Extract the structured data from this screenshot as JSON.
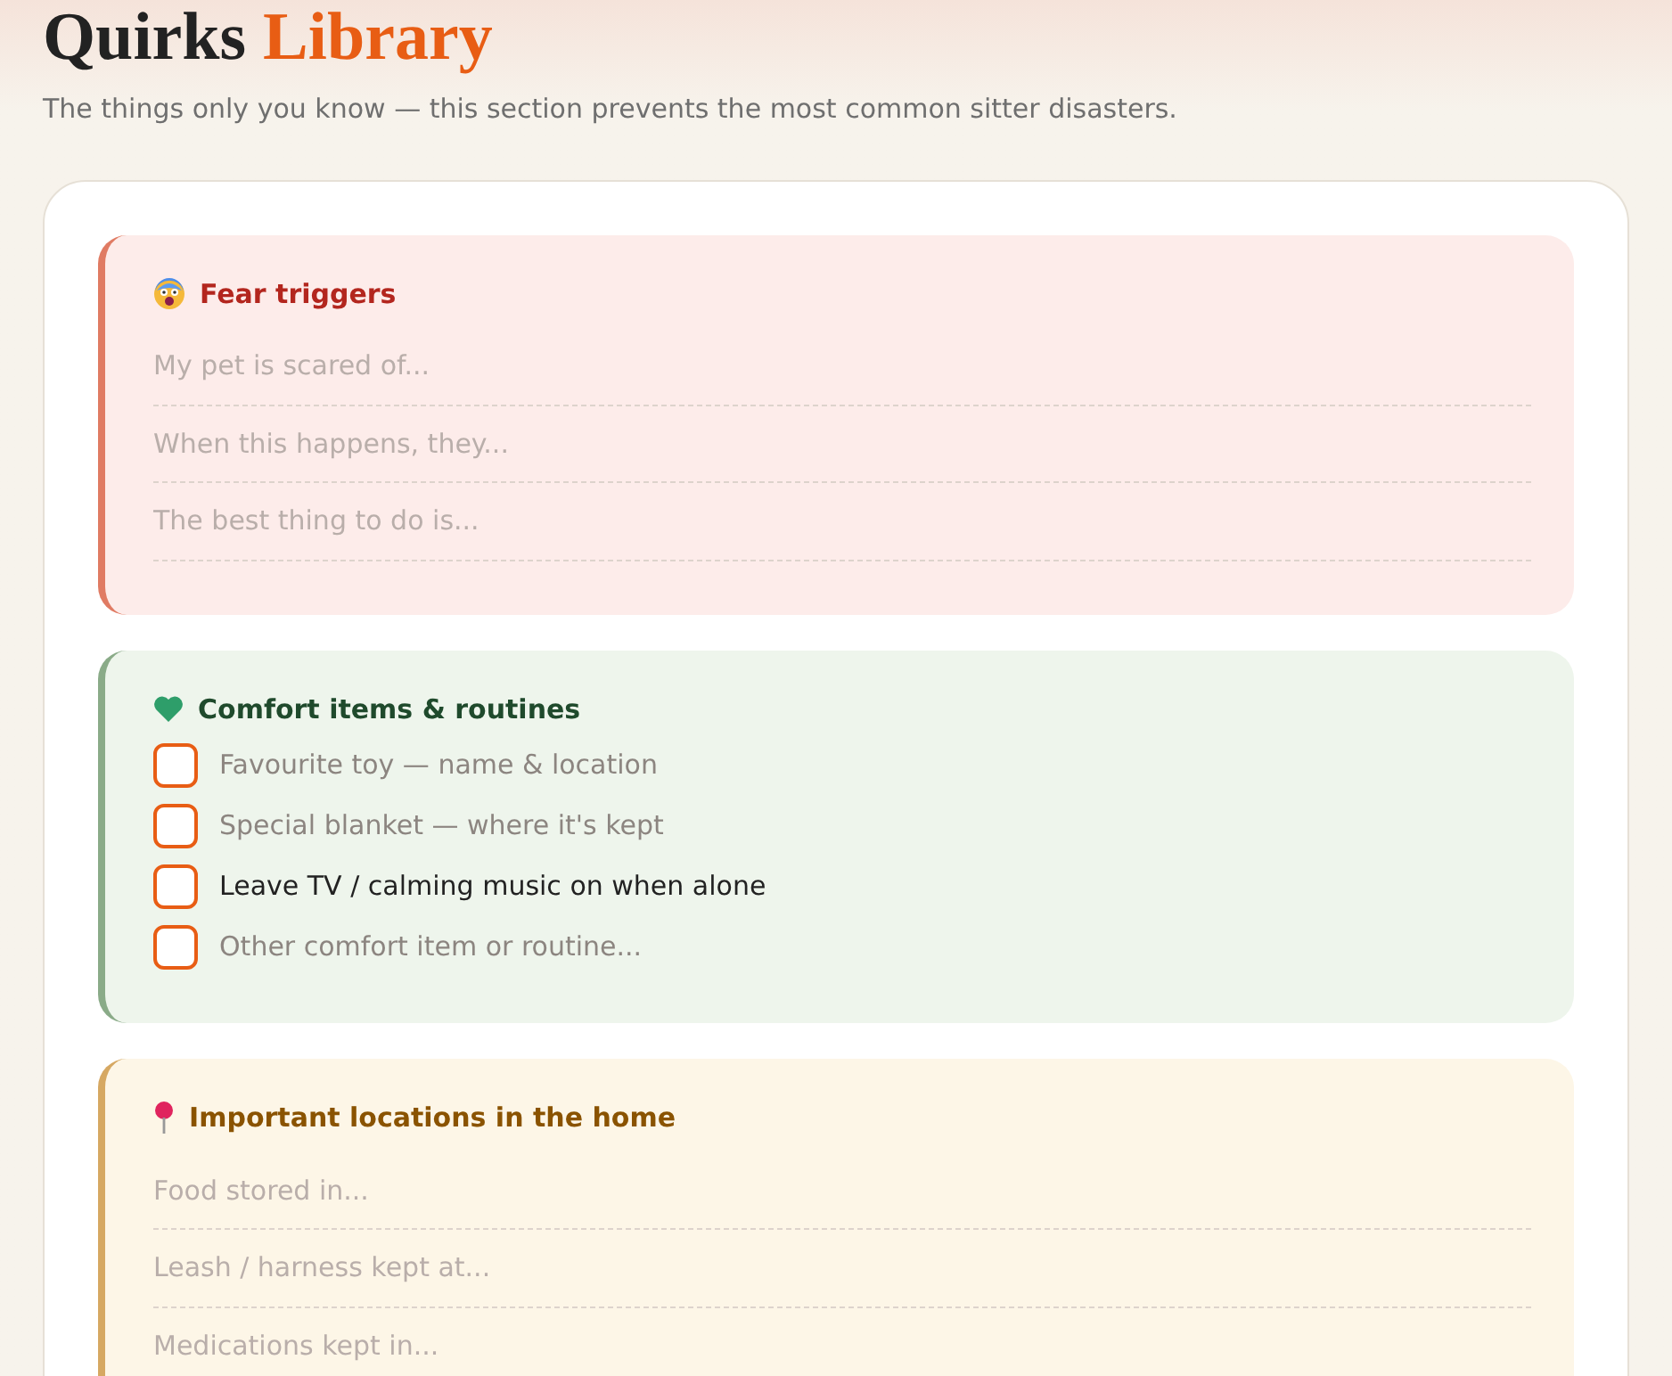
{
  "header": {
    "title": "Quirks",
    "title_accent": "Library",
    "subtitle": "The things only you know — this section prevents the most common sitter disasters."
  },
  "sections": [
    {
      "kind": "fields",
      "title": "Fear triggers",
      "color": "#e07b63",
      "fields": [
        {
          "placeholder": "My pet is scared of..."
        },
        {
          "placeholder": "When this happens, they..."
        },
        {
          "placeholder": "The best thing to do is..."
        }
      ]
    },
    {
      "kind": "checklist",
      "title": "Comfort items & routines",
      "color": "#8aab88",
      "items": [
        {
          "kind": "input",
          "placeholder": "Favourite toy — name & location",
          "checked": false
        },
        {
          "kind": "input",
          "placeholder": "Special blanket — where it's kept",
          "checked": false
        },
        {
          "kind": "label",
          "label": "Leave TV / calming music on when alone",
          "checked": false
        },
        {
          "kind": "input",
          "placeholder": "Other comfort item or routine...",
          "checked": false
        }
      ]
    },
    {
      "kind": "fields",
      "title": "Important locations in the home",
      "color": "#d6a862",
      "fields": [
        {
          "placeholder": "Food stored in..."
        },
        {
          "placeholder": "Leash / harness kept at..."
        },
        {
          "placeholder": "Medications kept in..."
        }
      ]
    }
  ]
}
